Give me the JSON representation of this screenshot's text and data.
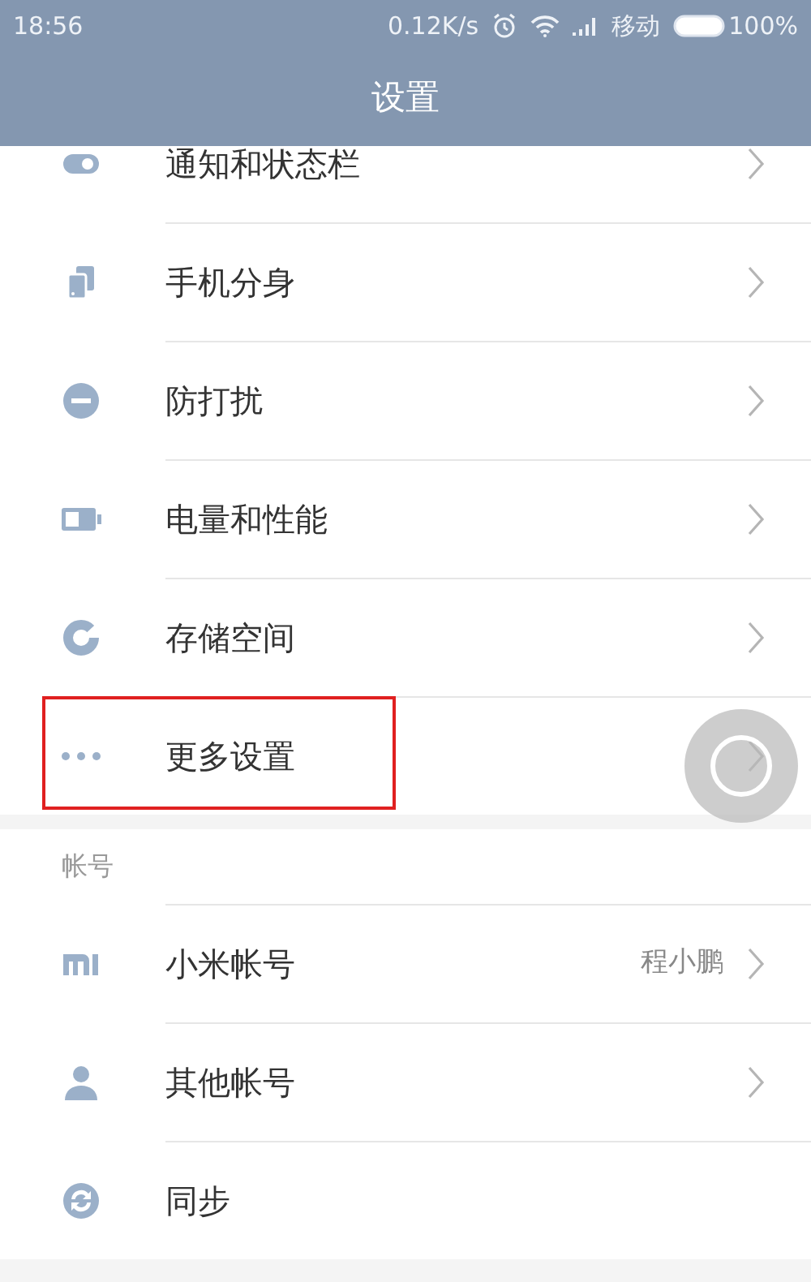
{
  "status_bar": {
    "time": "18:56",
    "speed": "0.12K/s",
    "carrier": "移动",
    "battery": "100%"
  },
  "title": "设置",
  "sections": [
    {
      "items": [
        {
          "kind": "toggle",
          "label": "通知和状态栏",
          "highlighted": false
        },
        {
          "kind": "phones",
          "label": "手机分身",
          "highlighted": false
        },
        {
          "kind": "minus",
          "label": "防打扰",
          "highlighted": false
        },
        {
          "kind": "battery",
          "label": "电量和性能",
          "highlighted": false
        },
        {
          "kind": "donut",
          "label": "存储空间",
          "highlighted": false
        },
        {
          "kind": "dots",
          "label": "更多设置",
          "highlighted": true
        }
      ]
    },
    {
      "header": "帐号",
      "items": [
        {
          "kind": "mi",
          "label": "小米帐号",
          "value": "程小鹏",
          "highlighted": false
        },
        {
          "kind": "person",
          "label": "其他帐号",
          "highlighted": false
        },
        {
          "kind": "sync",
          "label": "同步",
          "highlighted": false,
          "chevron": false
        }
      ]
    }
  ]
}
